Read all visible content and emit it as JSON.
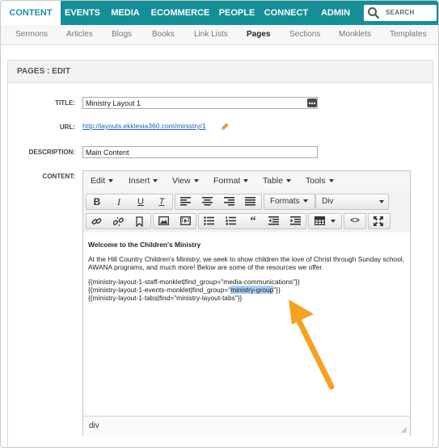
{
  "nav": {
    "tabs": [
      "CONTENT",
      "EVENTS",
      "MEDIA",
      "ECOMMERCE",
      "PEOPLE",
      "CONNECT",
      "ADMIN"
    ],
    "search_label": "SEARCH"
  },
  "subnav": {
    "items": [
      "Sermons",
      "Articles",
      "Blogs",
      "Books",
      "Link Lists",
      "Pages",
      "Sections",
      "Monklets",
      "Templates"
    ]
  },
  "page": {
    "title": "PAGES : EDIT",
    "fields": {
      "title_label": "TITLE:",
      "title_value": "Ministry Layout 1",
      "url_label": "URL:",
      "url_value": "http://layouts.ekklesia360.com/ministry/1",
      "description_label": "DESCRIPTION:",
      "description_value": "Main Content",
      "content_label": "CONTENT:"
    }
  },
  "editor": {
    "menus": [
      "Edit",
      "Insert",
      "View",
      "Format",
      "Table",
      "Tools"
    ],
    "formats_label": "Formats",
    "block_label": "Div",
    "body": {
      "heading": "Welcome to the Children's Ministry",
      "paragraph": "At the Hill Country Children's Ministry, we seek to show children the love of Christ through Sunday school, AWANA programs, and much more! Below are some of the resources we offer.",
      "line1": "{{ministry-layout-1-staff-monklet|find_group=\"media-communications\"}}",
      "line2_pre": "{{ministry-layout-1-events-monklet|find_group=\"",
      "line2_highlight": "ministry-group",
      "line2_post": "\"}}",
      "line3": "{{ministry-layout-1-tabs|find=\"ministry-layout-tabs\"}}"
    },
    "status_path": "div"
  },
  "colors": {
    "nav_bg": "#168e97",
    "active_tab_text": "#1a8fa6",
    "arrow": "#f5a122",
    "selection": "#a9cdf3",
    "link": "#1a62b8"
  }
}
